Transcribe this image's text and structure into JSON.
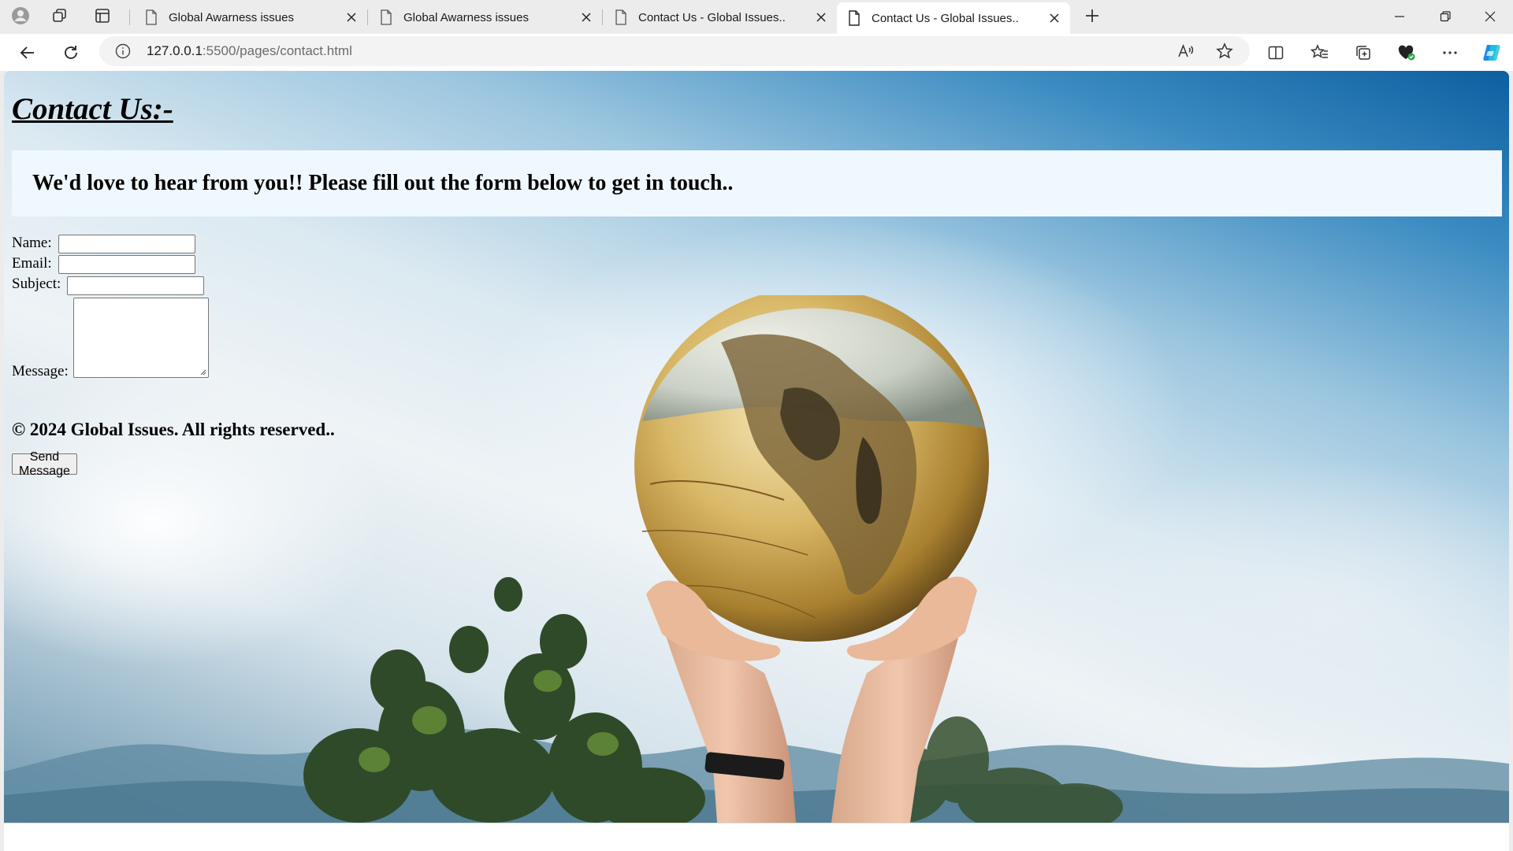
{
  "browser": {
    "tabs": [
      {
        "title": "Global Awarness issues",
        "active": false
      },
      {
        "title": "Global Awarness issues",
        "active": false
      },
      {
        "title": "Contact Us - Global Issues..",
        "active": false
      },
      {
        "title": "Contact Us - Global Issues..",
        "active": true
      }
    ],
    "address": {
      "host": "127.0.0.1",
      "rest": ":5500/pages/contact.html"
    }
  },
  "page": {
    "title": "Contact Us:-",
    "intro": "We'd love to hear from you!! Please fill out the form below to get in touch..",
    "form": {
      "name_label": "Name:",
      "email_label": "Email:",
      "subject_label": "Subject:",
      "message_label": "Message:",
      "name_value": "",
      "email_value": "",
      "subject_value": "",
      "message_value": "",
      "submit_label": "Send Message"
    },
    "footer": "© 2024 Global Issues. All rights reserved.."
  },
  "colors": {
    "intro_background": "#f0f8ff",
    "browser_chrome": "#ececec",
    "active_tab": "#ffffff"
  },
  "icons": [
    "profile-icon",
    "workspaces-icon",
    "tab-actions-icon",
    "page-icon",
    "close-icon",
    "new-tab-icon",
    "minimize-icon",
    "restore-icon",
    "window-close-icon",
    "back-icon",
    "reload-icon",
    "info-icon",
    "read-aloud-icon",
    "favorite-star-icon",
    "split-screen-icon",
    "favorites-icon",
    "collections-icon",
    "browser-essentials-icon",
    "more-icon",
    "copilot-icon"
  ]
}
